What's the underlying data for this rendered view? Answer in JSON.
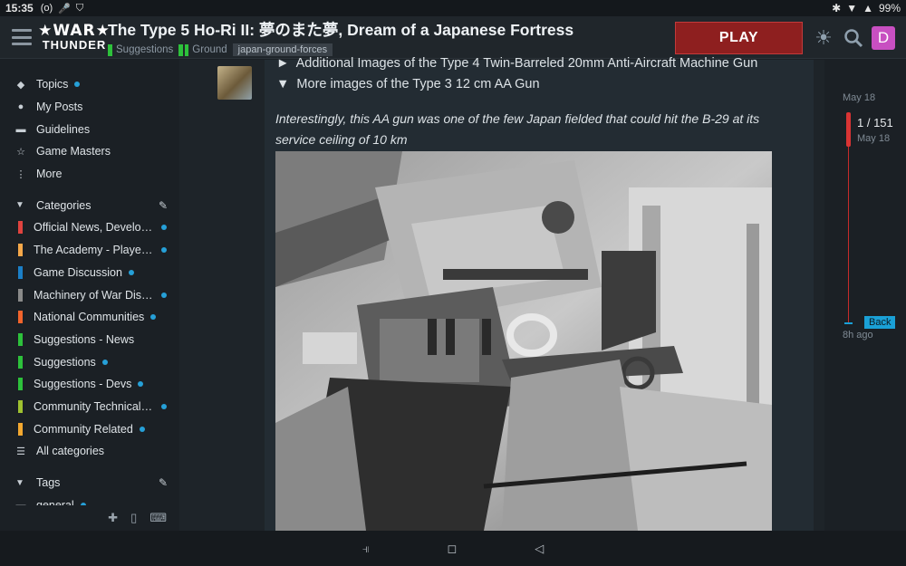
{
  "status_bar": {
    "time": "15:35",
    "left_icons": [
      "(o)",
      "🎤",
      "⛉"
    ],
    "battery": "99%",
    "right_icons": [
      "✱",
      "▼",
      "▲"
    ]
  },
  "header": {
    "logo_line1": "★WAR★",
    "logo_line2": "THUNDER",
    "title": "The Type 5 Ho-Ri II: 夢のまた夢, Dream of a Japanese Fortress",
    "crumbs": [
      "Suggestions",
      "Ground"
    ],
    "tag": "japan-ground-forces",
    "play_label": "PLAY",
    "avatar_letter": "D",
    "icons": [
      "sun-icon",
      "search-icon"
    ]
  },
  "sidebar": {
    "nav": [
      {
        "label": "Topics",
        "icon": "◆",
        "dot": true
      },
      {
        "label": "My Posts",
        "icon": "●",
        "dot": false
      },
      {
        "label": "Guidelines",
        "icon": "▬",
        "dot": false
      },
      {
        "label": "Game Masters",
        "icon": "☆",
        "dot": false
      },
      {
        "label": "More",
        "icon": "⋮",
        "dot": false
      }
    ],
    "categories_label": "Categories",
    "categories": [
      {
        "label": "Official News, Develop...",
        "color": "#e0433f"
      },
      {
        "label": "The Academy - Players ...",
        "color": "#f6a84a"
      },
      {
        "label": "Game Discussion",
        "color": "#1b7fc7"
      },
      {
        "label": "Machinery of War Discu...",
        "color": "#8a8a8a"
      },
      {
        "label": "National Communities",
        "color": "#f2642c"
      },
      {
        "label": "Suggestions - News",
        "color": "#2dc13b"
      },
      {
        "label": "Suggestions",
        "color": "#2dc13b"
      },
      {
        "label": "Suggestions - Devs",
        "color": "#2dc13b"
      },
      {
        "label": "Community Technical S...",
        "color": "#9fc130"
      },
      {
        "label": "Community Related",
        "color": "#f3a830"
      }
    ],
    "all_categories": "All categories",
    "tags_label": "Tags",
    "partial_tag": "general"
  },
  "post": {
    "detail_lines": [
      {
        "marker": "►",
        "text": "Additional Images of the Type 4 Twin-Barreled 20mm Anti-Aircraft Machine Gun"
      },
      {
        "marker": "▼",
        "text": "More images of the Type 3 12 cm AA Gun"
      }
    ],
    "italic_text": "Interestingly, this AA gun was one of the few Japan fielded that could hit the B-29 at its service ceiling of 10 km"
  },
  "timeline": {
    "start_date": "May 18",
    "count": "1 / 151",
    "current_date": "May 18",
    "back_label": "Back",
    "end_label": "8h ago"
  },
  "navbar": {
    "buttons": [
      "⫣",
      "◻",
      "◁"
    ]
  }
}
